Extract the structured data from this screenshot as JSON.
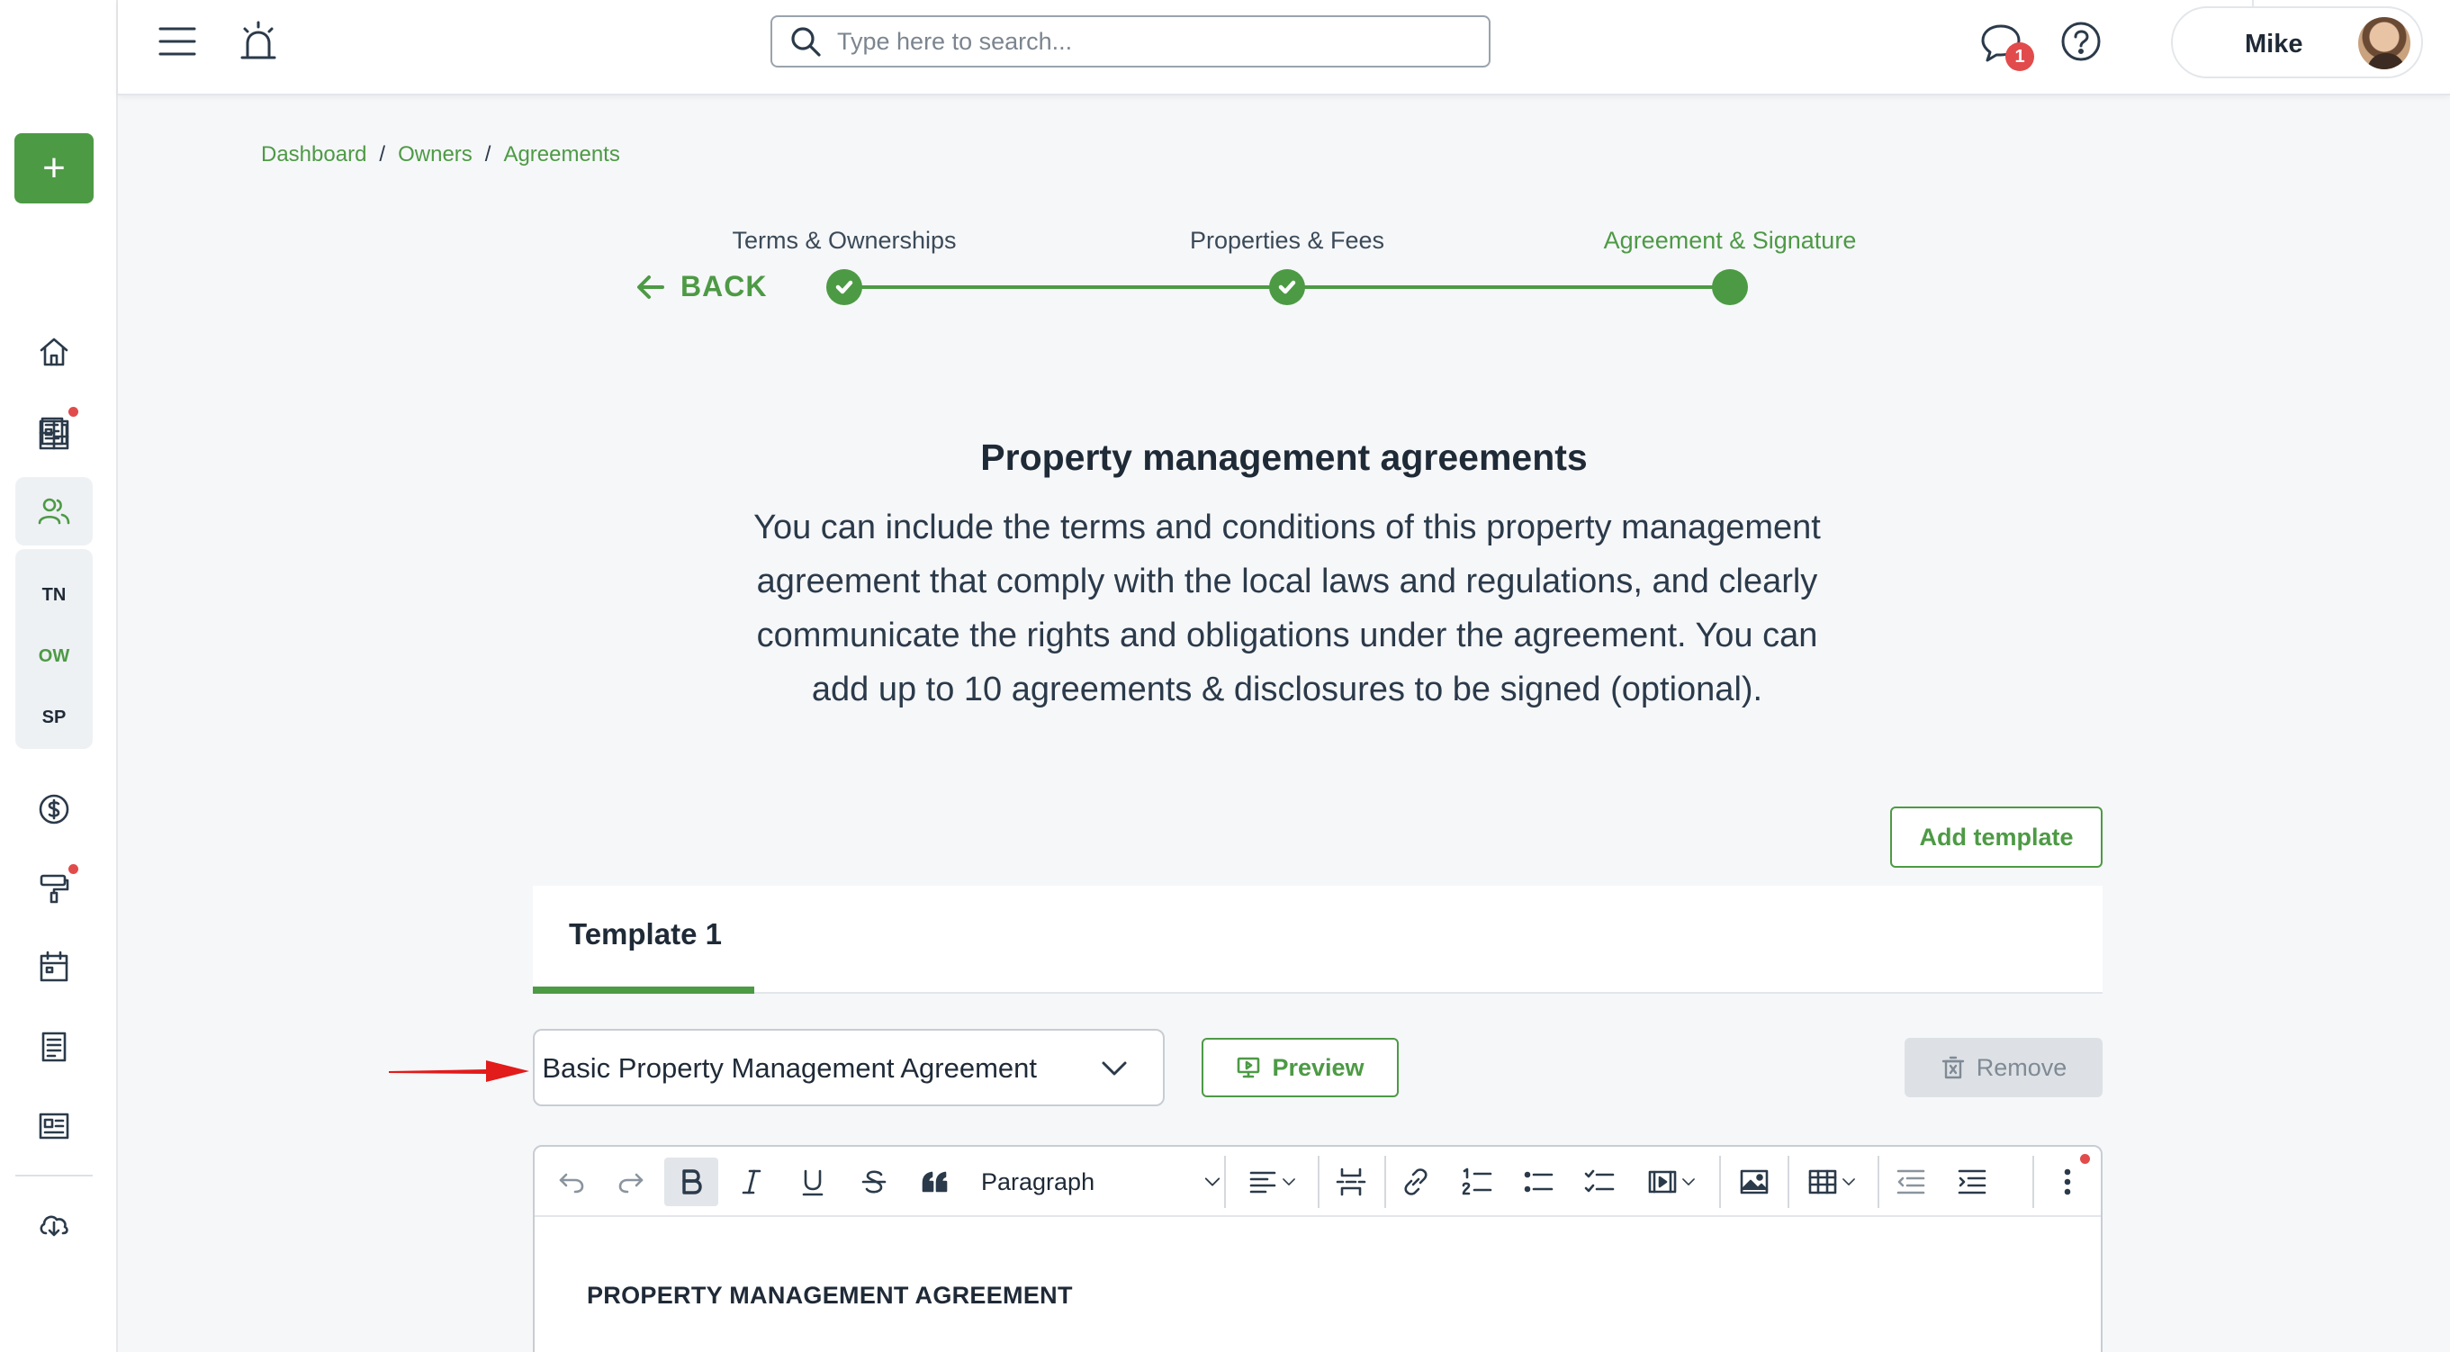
{
  "sidebar": {
    "add_label": "+",
    "abbreviations": [
      "TN",
      "OW",
      "SP"
    ]
  },
  "topbar": {
    "search_placeholder": "Type here to search...",
    "messages_badge": "1",
    "user_name": "Mike"
  },
  "breadcrumb": [
    "Dashboard",
    "Owners",
    "Agreements"
  ],
  "stepper": {
    "back_label": "BACK",
    "steps": [
      "Terms & Ownerships",
      "Properties & Fees",
      "Agreement & Signature"
    ]
  },
  "main": {
    "heading": "Property management agreements",
    "intro_lines": [
      "You can include the terms and conditions of this property management",
      "agreement that comply with the local laws and regulations, and clearly",
      "communicate the rights and obligations under the agreement. You can",
      "add up to 10 agreements & disclosures to be signed (optional)."
    ],
    "add_template_label": "Add template",
    "tab_label": "Template 1",
    "template_select_value": "Basic Property Management Agreement",
    "preview_label": "Preview",
    "remove_label": "Remove"
  },
  "editor": {
    "block_format": "Paragraph",
    "document_title": "PROPERTY MANAGEMENT AGREEMENT"
  },
  "colors": {
    "brand_green": "#4d9a45",
    "alert_red": "#e24b4b"
  }
}
